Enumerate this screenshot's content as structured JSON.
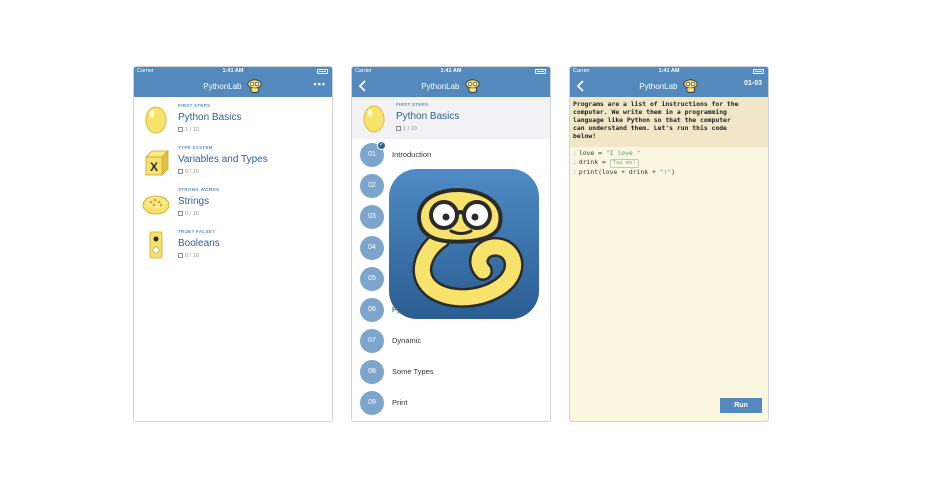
{
  "status_bar": {
    "carrier": "Carrier",
    "time": "1:41 AM"
  },
  "app": {
    "title": "PythonLab"
  },
  "courses_screen": {
    "more_label": "•••",
    "courses": [
      {
        "category": "FIRST STEPS",
        "name": "Python Basics",
        "progress": "1 / 10",
        "icon": "egg-icon"
      },
      {
        "category": "TYPE SYSTEM",
        "name": "Variables and Types",
        "progress": "0 / 10",
        "icon": "variable-box-icon"
      },
      {
        "category": "STRONG WORDS",
        "name": "Strings",
        "progress": "0 / 10",
        "icon": "letters-plate-icon"
      },
      {
        "category": "TRUE? FALSE?",
        "name": "Booleans",
        "progress": "0 / 10",
        "icon": "switch-icon"
      }
    ]
  },
  "lessons_screen": {
    "course": {
      "category": "FIRST STEPS",
      "name": "Python Basics",
      "progress": "1 / 10"
    },
    "lessons": [
      {
        "num": "01",
        "label": "Introduction",
        "done": true
      },
      {
        "num": "02",
        "label": "",
        "done": false
      },
      {
        "num": "03",
        "label": "",
        "done": false
      },
      {
        "num": "04",
        "label": "",
        "done": false
      },
      {
        "num": "05",
        "label": "",
        "done": false
      },
      {
        "num": "06",
        "label": "Py",
        "done": false
      },
      {
        "num": "07",
        "label": "Dynamic",
        "done": false
      },
      {
        "num": "08",
        "label": "Some Types",
        "done": false
      },
      {
        "num": "09",
        "label": "Print",
        "done": false
      }
    ]
  },
  "lesson_screen": {
    "code_id": "01-03",
    "intro_lines": [
      "Programs are a list of instructions for the",
      "computer. We write them in a programming",
      "language like Python so that the computer",
      "can understand them. Let's run this code",
      "below!"
    ],
    "code": {
      "line1_left": "love = ",
      "line1_str": "\"I love \"",
      "line2_left": "drink = ",
      "line2_tap": "Tap me!",
      "line3_left": "print(love + drink + ",
      "line3_str": "\"!\"",
      "line3_right": ")",
      "gutter": ":"
    },
    "run_label": "Run"
  },
  "colors": {
    "brand": "#5389bd",
    "code_bg": "#fbf6df",
    "intro_bg": "#efe7c8",
    "icon_yellow": "#f7e26b"
  }
}
